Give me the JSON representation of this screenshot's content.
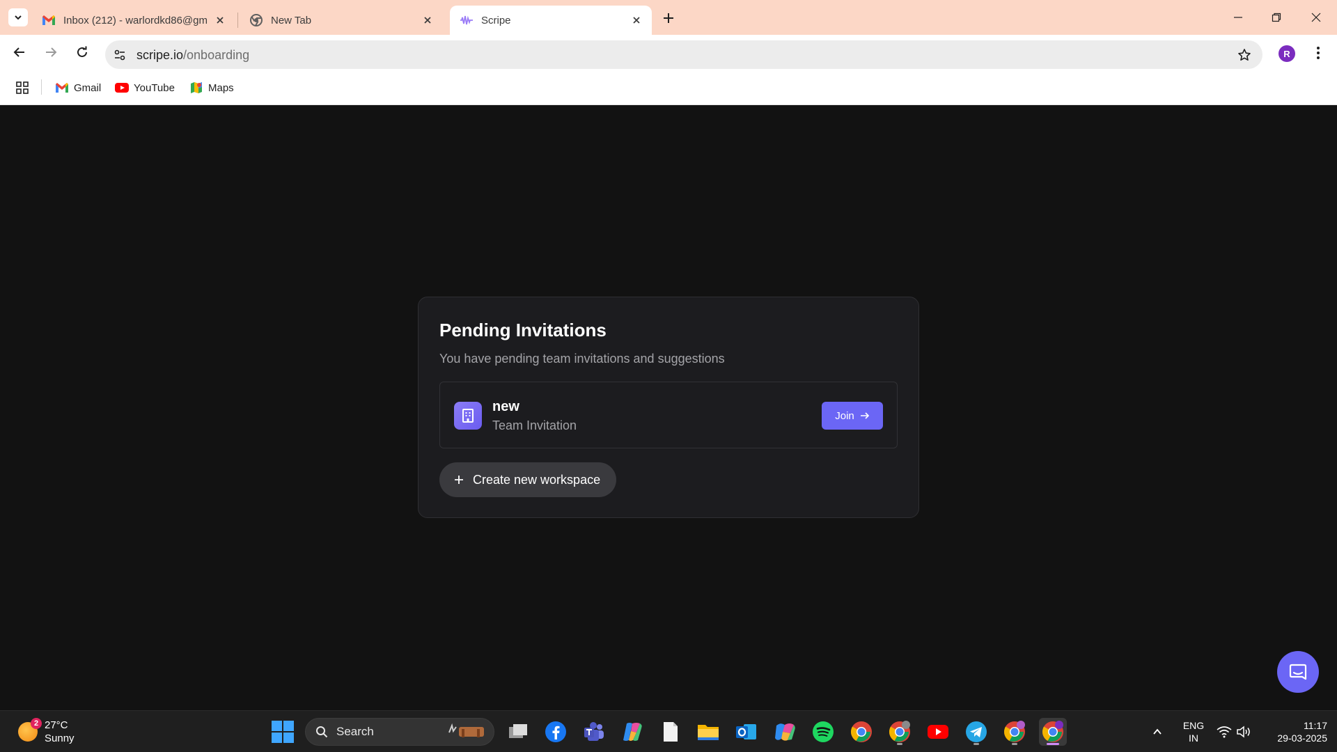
{
  "browser": {
    "tabs": [
      {
        "title": "Inbox (212) - warlordkd86@gm",
        "icon": "gmail-icon",
        "active": false
      },
      {
        "title": "New Tab",
        "icon": "chrome-icon",
        "active": false
      },
      {
        "title": "Scripe",
        "icon": "scripe-icon",
        "active": true
      }
    ],
    "url_domain": "scripe.io",
    "url_path": "/onboarding",
    "profile_initial": "R",
    "bookmarks": [
      {
        "label": "Gmail",
        "icon": "gmail-icon"
      },
      {
        "label": "YouTube",
        "icon": "youtube-icon"
      },
      {
        "label": "Maps",
        "icon": "maps-icon"
      }
    ]
  },
  "onboarding": {
    "title": "Pending Invitations",
    "subtitle": "You have pending team invitations and suggestions",
    "invitation": {
      "team_name": "new",
      "type": "Team Invitation",
      "join_label": "Join"
    },
    "create_workspace_label": "Create new workspace"
  },
  "taskbar": {
    "weather": {
      "temperature": "27°C",
      "condition": "Sunny",
      "badge": "2"
    },
    "search_label": "Search",
    "language_line1": "ENG",
    "language_line2": "IN",
    "time": "11:17",
    "date": "29-03-2025"
  },
  "colors": {
    "tabstrip": "#fcd7c6",
    "page_background": "#121212",
    "card_background": "#1c1c1f",
    "accent": "#6b66f5",
    "secondary_button": "#3a3a3e"
  }
}
